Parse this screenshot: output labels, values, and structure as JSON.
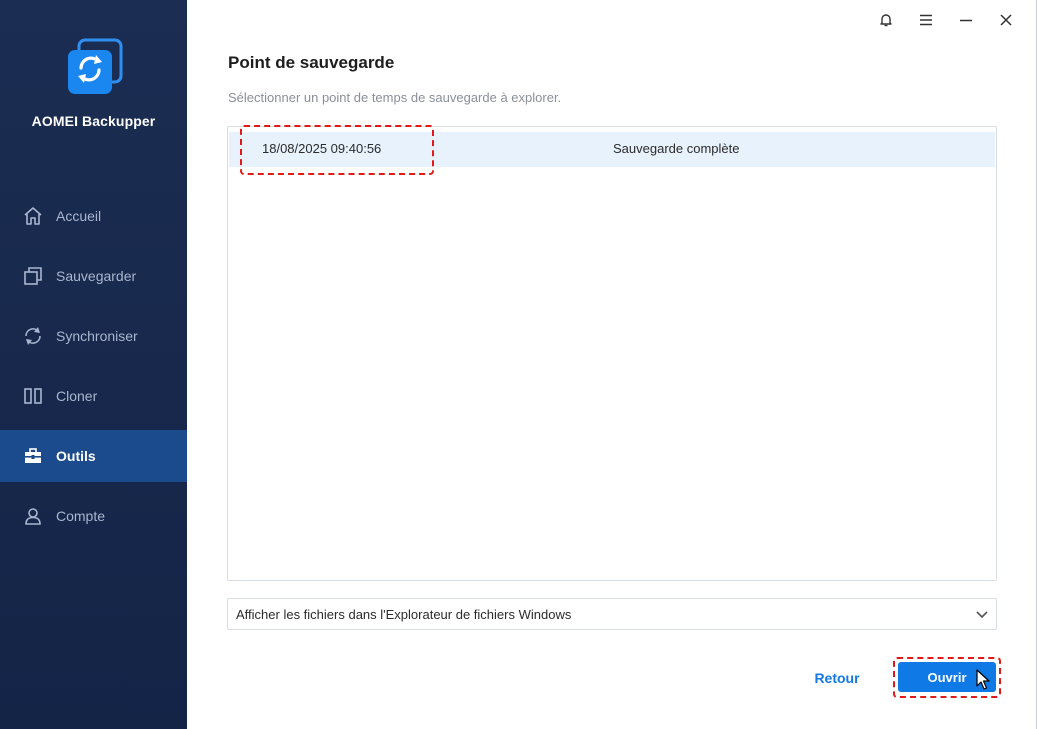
{
  "app": {
    "name": "AOMEI Backupper"
  },
  "sidebar": {
    "items": [
      {
        "label": "Accueil",
        "icon": "home-icon",
        "active": false
      },
      {
        "label": "Sauvegarder",
        "icon": "backup-icon",
        "active": false
      },
      {
        "label": "Synchroniser",
        "icon": "sync-icon",
        "active": false
      },
      {
        "label": "Cloner",
        "icon": "clone-icon",
        "active": false
      },
      {
        "label": "Outils",
        "icon": "toolbox-icon",
        "active": true
      },
      {
        "label": "Compte",
        "icon": "user-icon",
        "active": false
      }
    ]
  },
  "titlebar": {
    "icons": [
      "bell-icon",
      "menu-icon",
      "minimize-icon",
      "close-icon"
    ]
  },
  "page": {
    "title": "Point de sauvegarde",
    "subtitle": "Sélectionner un point de temps de sauvegarde à explorer."
  },
  "backup_points": [
    {
      "datetime": "18/08/2025 09:40:56",
      "type": "Sauvegarde complète",
      "selected": true
    }
  ],
  "open_mode": {
    "selected": "Afficher les fichiers dans l'Explorateur de fichiers Windows"
  },
  "buttons": {
    "back": "Retour",
    "open": "Ouvrir"
  },
  "colors": {
    "sidebar_bg": "#1b2d52",
    "sidebar_active": "#1b4a8d",
    "accent": "#0f7ae5",
    "selected_row": "#e8f2fc",
    "highlight": "#e01919"
  }
}
